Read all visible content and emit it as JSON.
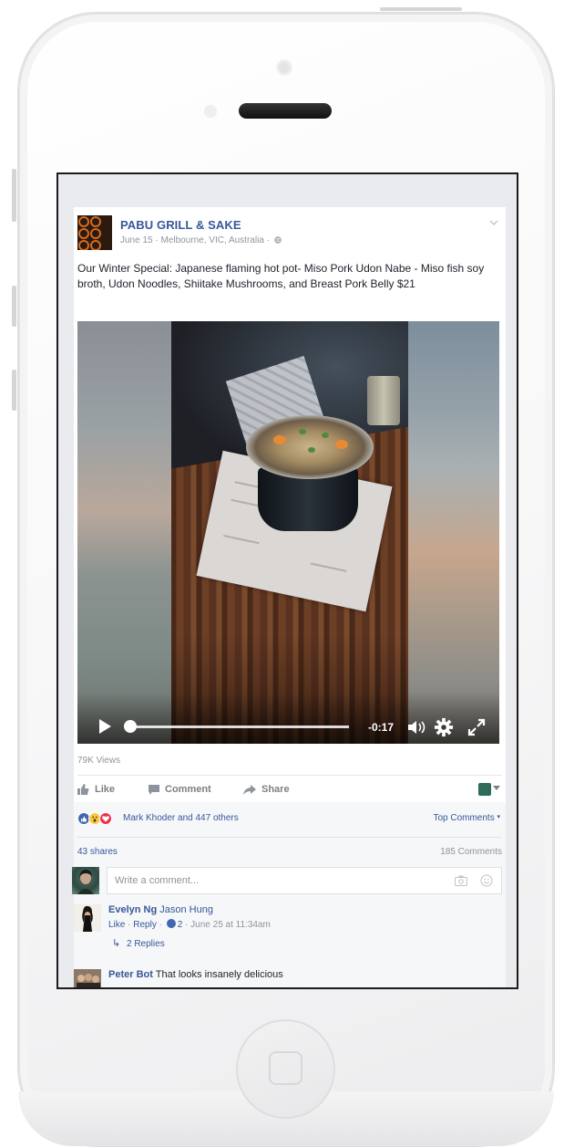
{
  "post": {
    "page_name": "PABU GRILL & SAKE",
    "meta": "June 15 · Melbourne, VIC, Australia ·",
    "text": "Our Winter Special: Japanese flaming hot pot- Miso Pork Udon Nabe - Miso fish soy broth, Udon Noodles, Shiitake Mushrooms, and Breast Pork Belly $21",
    "video": {
      "time_remaining": "-0:17",
      "progress": 0.0
    },
    "views": "79K Views"
  },
  "actions": {
    "like": "Like",
    "comment": "Comment",
    "share": "Share"
  },
  "feedback": {
    "reactions_text": "Mark Khoder and 447 others",
    "top_comments": "Top Comments",
    "shares": "43 shares",
    "comment_count": "185 Comments"
  },
  "composer": {
    "placeholder": "Write a comment..."
  },
  "comments": [
    {
      "name": "Evelyn Ng",
      "mention": "Jason Hung",
      "text": "",
      "like": "Like",
      "reply": "Reply",
      "likes": "2",
      "time": "June 25 at 11:34am",
      "replies": "2 Replies"
    },
    {
      "name": "Peter Bot",
      "mention": "",
      "text": "That looks insanely delicious"
    }
  ],
  "colors": {
    "link_blue": "#365899",
    "like_blue": "#4267b2",
    "gray_text": "#90949c"
  }
}
